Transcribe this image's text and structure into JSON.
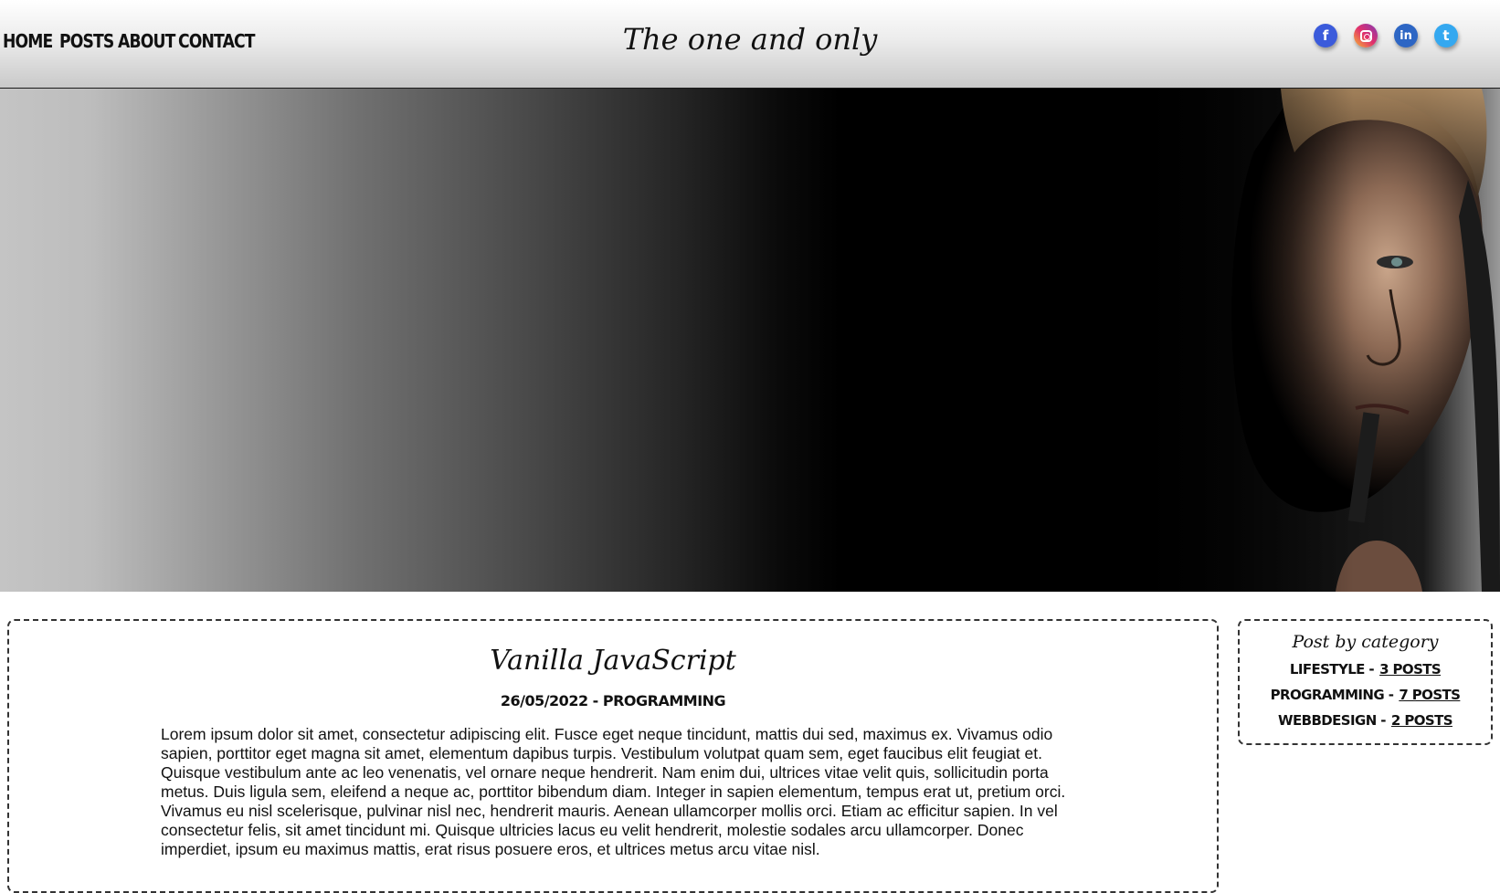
{
  "nav": {
    "home": "HOME",
    "posts": "POSTS",
    "about": "ABOUT",
    "contact": "CONTACT"
  },
  "brand": {
    "title": "The one and only"
  },
  "social": {
    "facebook_glyph": "f",
    "linkedin_glyph": "in",
    "twitter_glyph": "t",
    "icons": [
      "facebook-icon",
      "instagram-icon",
      "linkedin-icon",
      "twitter-icon"
    ]
  },
  "post": {
    "title": "Vanilla JavaScript",
    "meta": "26/05/2022 - PROGRAMMING",
    "body": "Lorem ipsum dolor sit amet, consectetur adipiscing elit. Fusce eget neque tincidunt, mattis dui sed, maximus ex. Vivamus odio sapien, porttitor eget magna sit amet, elementum dapibus turpis. Vestibulum volutpat quam sem, eget faucibus elit feugiat et. Quisque vestibulum ante ac leo venenatis, vel ornare neque hendrerit. Nam enim dui, ultrices vitae velit quis, sollicitudin porta metus. Duis ligula sem, eleifend a neque ac, porttitor bibendum diam. Integer in sapien elementum, tempus erat ut, pretium orci. Vivamus eu nisl scelerisque, pulvinar nisl nec, hendrerit mauris. Aenean ullamcorper mollis orci. Etiam ac efficitur sapien. In vel consectetur felis, sit amet tincidunt mi. Quisque ultricies lacus eu velit hendrerit, molestie sodales arcu ullamcorper. Donec imperdiet, ipsum eu maximus mattis, erat risus posuere eros, et ultrices metus arcu vitae nisl."
  },
  "sidebar": {
    "title": "Post by category",
    "categories": [
      {
        "name": "LIFESTYLE -",
        "count": "3 POSTS"
      },
      {
        "name": "PROGRAMMING -",
        "count": "7 POSTS"
      },
      {
        "name": "WEBBDESIGN -",
        "count": "2 POSTS"
      }
    ]
  },
  "colors": {
    "facebook": "#3b5bdb",
    "linkedin": "#2d66c4",
    "twitter": "#34a8f0",
    "text": "#111111"
  }
}
